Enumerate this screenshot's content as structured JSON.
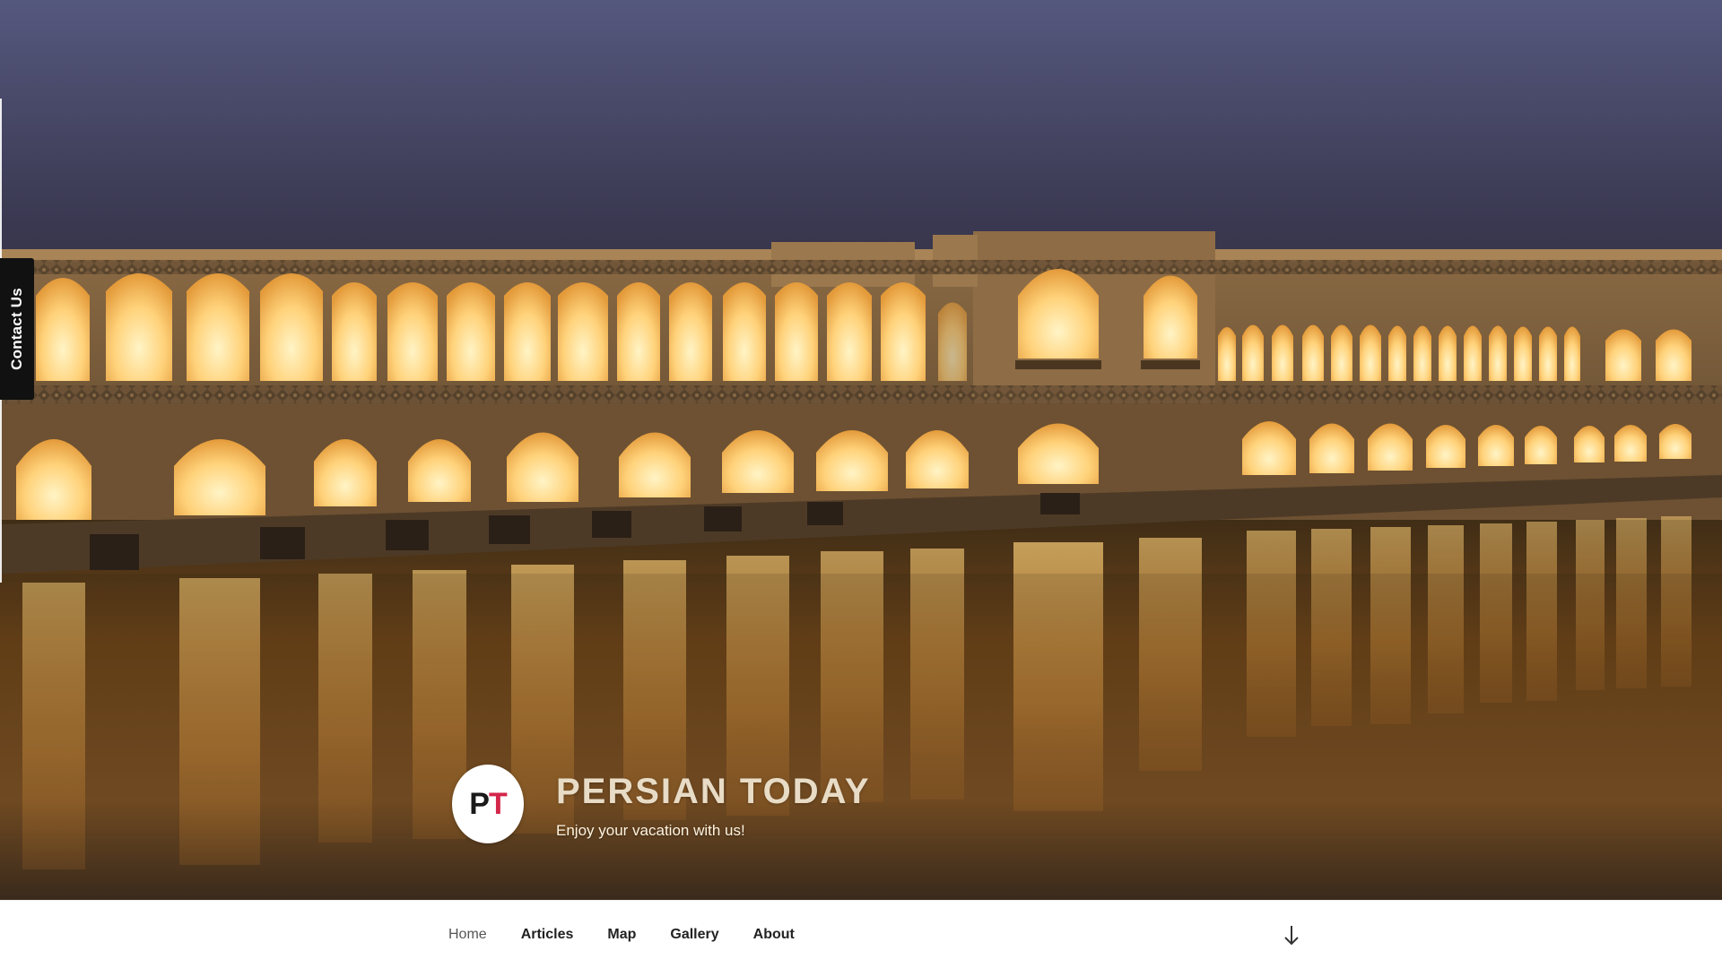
{
  "contact_tab": {
    "label": "Contact Us"
  },
  "branding": {
    "logo_letters": {
      "first": "P",
      "second": "T"
    },
    "title": "PERSIAN TODAY",
    "tagline": "Enjoy your vacation with us!"
  },
  "nav": {
    "items": [
      {
        "label": "Home",
        "active": true
      },
      {
        "label": "Articles",
        "active": false
      },
      {
        "label": "Map",
        "active": false
      },
      {
        "label": "Gallery",
        "active": false
      },
      {
        "label": "About",
        "active": false
      }
    ],
    "scroll_icon": "arrow-down-icon"
  },
  "hero": {
    "image_subject": "illuminated arched stone bridge reflected in river at dusk"
  },
  "colors": {
    "logo_accent": "#d3264a",
    "title": "#e8dcc6",
    "arch_glow": "#ffd27a",
    "sky": "#3c3a5a",
    "contact_tab_bg": "#111111"
  }
}
